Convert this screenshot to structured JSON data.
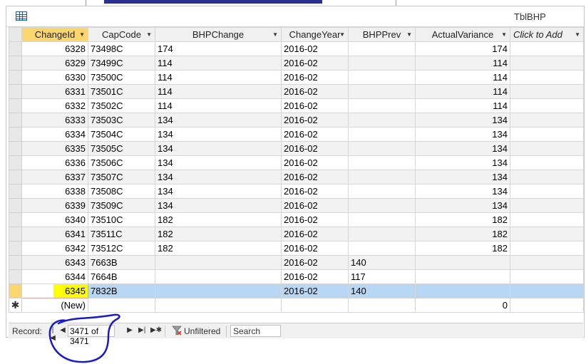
{
  "window": {
    "title": "TblBHP"
  },
  "grid": {
    "columns": [
      {
        "label": "ChangeId",
        "dropdown": true
      },
      {
        "label": "CapCode",
        "dropdown": true
      },
      {
        "label": "BHPChange",
        "dropdown": true
      },
      {
        "label": "ChangeYear",
        "dropdown": true
      },
      {
        "label": "BHPPrev",
        "dropdown": true
      },
      {
        "label": "ActualVariance",
        "dropdown": true
      },
      {
        "label": "Click to Add",
        "dropdown": true
      }
    ],
    "rows": [
      {
        "ChangeId": "6328",
        "CapCode": "73498C",
        "BHPChange": "174",
        "ChangeYear": "2016-02",
        "BHPPrev": "",
        "ActualVariance": "174"
      },
      {
        "ChangeId": "6329",
        "CapCode": "73499C",
        "BHPChange": "114",
        "ChangeYear": "2016-02",
        "BHPPrev": "",
        "ActualVariance": "114"
      },
      {
        "ChangeId": "6330",
        "CapCode": "73500C",
        "BHPChange": "114",
        "ChangeYear": "2016-02",
        "BHPPrev": "",
        "ActualVariance": "114"
      },
      {
        "ChangeId": "6331",
        "CapCode": "73501C",
        "BHPChange": "114",
        "ChangeYear": "2016-02",
        "BHPPrev": "",
        "ActualVariance": "114"
      },
      {
        "ChangeId": "6332",
        "CapCode": "73502C",
        "BHPChange": "114",
        "ChangeYear": "2016-02",
        "BHPPrev": "",
        "ActualVariance": "114"
      },
      {
        "ChangeId": "6333",
        "CapCode": "73503C",
        "BHPChange": "134",
        "ChangeYear": "2016-02",
        "BHPPrev": "",
        "ActualVariance": "134"
      },
      {
        "ChangeId": "6334",
        "CapCode": "73504C",
        "BHPChange": "134",
        "ChangeYear": "2016-02",
        "BHPPrev": "",
        "ActualVariance": "134"
      },
      {
        "ChangeId": "6335",
        "CapCode": "73505C",
        "BHPChange": "134",
        "ChangeYear": "2016-02",
        "BHPPrev": "",
        "ActualVariance": "134"
      },
      {
        "ChangeId": "6336",
        "CapCode": "73506C",
        "BHPChange": "134",
        "ChangeYear": "2016-02",
        "BHPPrev": "",
        "ActualVariance": "134"
      },
      {
        "ChangeId": "6337",
        "CapCode": "73507C",
        "BHPChange": "134",
        "ChangeYear": "2016-02",
        "BHPPrev": "",
        "ActualVariance": "134"
      },
      {
        "ChangeId": "6338",
        "CapCode": "73508C",
        "BHPChange": "134",
        "ChangeYear": "2016-02",
        "BHPPrev": "",
        "ActualVariance": "134"
      },
      {
        "ChangeId": "6339",
        "CapCode": "73509C",
        "BHPChange": "134",
        "ChangeYear": "2016-02",
        "BHPPrev": "",
        "ActualVariance": "134"
      },
      {
        "ChangeId": "6340",
        "CapCode": "73510C",
        "BHPChange": "182",
        "ChangeYear": "2016-02",
        "BHPPrev": "",
        "ActualVariance": "182"
      },
      {
        "ChangeId": "6341",
        "CapCode": "73511C",
        "BHPChange": "182",
        "ChangeYear": "2016-02",
        "BHPPrev": "",
        "ActualVariance": "182"
      },
      {
        "ChangeId": "6342",
        "CapCode": "73512C",
        "BHPChange": "182",
        "ChangeYear": "2016-02",
        "BHPPrev": "",
        "ActualVariance": "182"
      },
      {
        "ChangeId": "6343",
        "CapCode": "7663B",
        "BHPChange": "",
        "ChangeYear": "2016-02",
        "BHPPrev": "140",
        "ActualVariance": ""
      },
      {
        "ChangeId": "6344",
        "CapCode": "7664B",
        "BHPChange": "",
        "ChangeYear": "2016-02",
        "BHPPrev": "117",
        "ActualVariance": ""
      },
      {
        "ChangeId": "6345",
        "CapCode": "7832B",
        "BHPChange": "",
        "ChangeYear": "2016-02",
        "BHPPrev": "140",
        "ActualVariance": "",
        "current": true
      }
    ],
    "new_row": {
      "ChangeId": "(New)",
      "ActualVariance": "0"
    }
  },
  "nav": {
    "record_label": "Record:",
    "record_position": "3471 of 3471",
    "filter_label": "Unfiltered",
    "search_placeholder": "Search",
    "buttons": [
      "first-record",
      "previous-record",
      "next-record",
      "last-record",
      "new-record"
    ]
  },
  "colors": {
    "active_header": "#fbd56d",
    "selected_row": "#b8d7f5",
    "highlight": "#ffff00",
    "annotation": "#1a1ac8"
  }
}
